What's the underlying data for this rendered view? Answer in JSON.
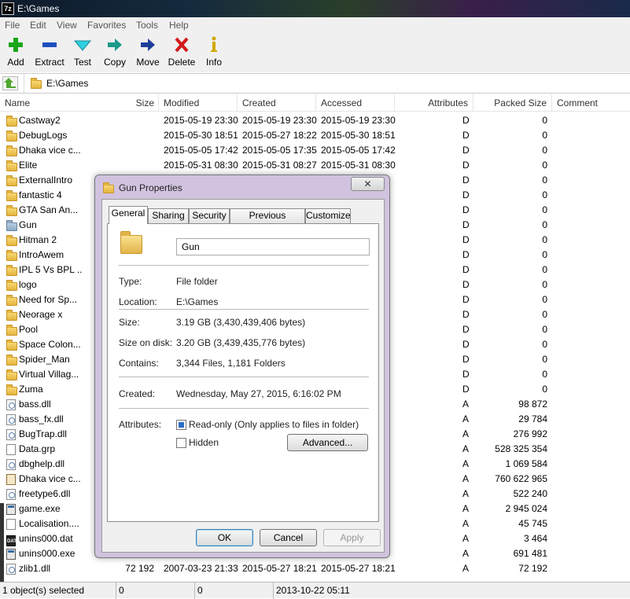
{
  "window": {
    "title": "E:\\Games",
    "app_icon_text": "7z"
  },
  "menu": [
    "File",
    "Edit",
    "View",
    "Favorites",
    "Tools",
    "Help"
  ],
  "toolbar": [
    {
      "label": "Add",
      "icon": "plus-icon"
    },
    {
      "label": "Extract",
      "icon": "minus-icon"
    },
    {
      "label": "Test",
      "icon": "check-icon"
    },
    {
      "label": "Copy",
      "icon": "copy-arrow-icon"
    },
    {
      "label": "Move",
      "icon": "move-arrow-icon"
    },
    {
      "label": "Delete",
      "icon": "x-icon"
    },
    {
      "label": "Info",
      "icon": "info-icon"
    }
  ],
  "address": {
    "path": "E:\\Games"
  },
  "columns": [
    "Name",
    "Size",
    "Modified",
    "Created",
    "Accessed",
    "Attributes",
    "Packed Size",
    "Comment"
  ],
  "rows": [
    {
      "name": "Castway2",
      "icon": "folder",
      "size": "",
      "modified": "2015-05-19 23:30",
      "created": "2015-05-19 23:30",
      "accessed": "2015-05-19 23:30",
      "attr": "D",
      "packed": "0"
    },
    {
      "name": "DebugLogs",
      "icon": "folder",
      "size": "",
      "modified": "2015-05-30 18:51",
      "created": "2015-05-27 18:22",
      "accessed": "2015-05-30 18:51",
      "attr": "D",
      "packed": "0"
    },
    {
      "name": "Dhaka vice c...",
      "icon": "folder",
      "size": "",
      "modified": "2015-05-05 17:42",
      "created": "2015-05-05 17:35",
      "accessed": "2015-05-05 17:42",
      "attr": "D",
      "packed": "0"
    },
    {
      "name": "Elite",
      "icon": "folder",
      "size": "",
      "modified": "2015-05-31 08:30",
      "created": "2015-05-31 08:27",
      "accessed": "2015-05-31 08:30",
      "attr": "D",
      "packed": "0"
    },
    {
      "name": "ExternalIntro",
      "icon": "folder",
      "size": "",
      "modified": "",
      "created": "",
      "accessed": "",
      "attr": "D",
      "packed": "0"
    },
    {
      "name": "fantastic 4",
      "icon": "folder",
      "size": "",
      "modified": "",
      "created": "",
      "accessed": "",
      "attr": "D",
      "packed": "0"
    },
    {
      "name": "GTA San An...",
      "icon": "folder",
      "size": "",
      "modified": "",
      "created": "",
      "accessed": "",
      "attr": "D",
      "packed": "0"
    },
    {
      "name": "Gun",
      "icon": "folder-gun",
      "size": "",
      "modified": "",
      "created": "",
      "accessed": "",
      "attr": "D",
      "packed": "0"
    },
    {
      "name": "Hitman 2",
      "icon": "folder",
      "size": "",
      "modified": "",
      "created": "",
      "accessed": "",
      "attr": "D",
      "packed": "0"
    },
    {
      "name": "IntroAwem",
      "icon": "folder",
      "size": "",
      "modified": "",
      "created": "",
      "accessed": "",
      "attr": "D",
      "packed": "0"
    },
    {
      "name": "IPL 5 Vs BPL ...",
      "icon": "folder",
      "size": "",
      "modified": "",
      "created": "",
      "accessed": "",
      "attr": "D",
      "packed": "0"
    },
    {
      "name": "logo",
      "icon": "folder",
      "size": "",
      "modified": "",
      "created": "",
      "accessed": "",
      "attr": "D",
      "packed": "0"
    },
    {
      "name": "Need for Sp...",
      "icon": "folder",
      "size": "",
      "modified": "",
      "created": "",
      "accessed": "",
      "attr": "D",
      "packed": "0"
    },
    {
      "name": "Neorage x",
      "icon": "folder",
      "size": "",
      "modified": "",
      "created": "",
      "accessed": "",
      "attr": "D",
      "packed": "0"
    },
    {
      "name": "Pool",
      "icon": "folder",
      "size": "",
      "modified": "",
      "created": "",
      "accessed": "",
      "attr": "D",
      "packed": "0"
    },
    {
      "name": "Space Colon...",
      "icon": "folder",
      "size": "",
      "modified": "",
      "created": "",
      "accessed": "",
      "attr": "D",
      "packed": "0"
    },
    {
      "name": "Spider_Man",
      "icon": "folder",
      "size": "",
      "modified": "",
      "created": "",
      "accessed": "",
      "attr": "D",
      "packed": "0"
    },
    {
      "name": "Virtual Villag...",
      "icon": "folder",
      "size": "",
      "modified": "",
      "created": "",
      "accessed": "",
      "attr": "D",
      "packed": "0"
    },
    {
      "name": "Zuma",
      "icon": "folder",
      "size": "",
      "modified": "",
      "created": "",
      "accessed": "",
      "attr": "D",
      "packed": "0"
    },
    {
      "name": "bass.dll",
      "icon": "dll",
      "size": "",
      "modified": "",
      "created": "",
      "accessed": "",
      "attr": "A",
      "packed": "98 872"
    },
    {
      "name": "bass_fx.dll",
      "icon": "dll",
      "size": "",
      "modified": "",
      "created": "",
      "accessed": "",
      "attr": "A",
      "packed": "29 784"
    },
    {
      "name": "BugTrap.dll",
      "icon": "dll",
      "size": "",
      "modified": "",
      "created": "",
      "accessed": "",
      "attr": "A",
      "packed": "276 992"
    },
    {
      "name": "Data.grp",
      "icon": "file",
      "size": "",
      "modified": "",
      "created": "",
      "accessed": "",
      "attr": "A",
      "packed": "528 325 354"
    },
    {
      "name": "dbghelp.dll",
      "icon": "dll",
      "size": "",
      "modified": "",
      "created": "",
      "accessed": "",
      "attr": "A",
      "packed": "1 069 584"
    },
    {
      "name": "Dhaka vice c...",
      "icon": "img",
      "size": "",
      "modified": "",
      "created": "",
      "accessed": "",
      "attr": "A",
      "packed": "760 622 965"
    },
    {
      "name": "freetype6.dll",
      "icon": "dll",
      "size": "",
      "modified": "",
      "created": "",
      "accessed": "",
      "attr": "A",
      "packed": "522 240"
    },
    {
      "name": "game.exe",
      "icon": "exe",
      "size": "",
      "modified": "",
      "created": "",
      "accessed": "",
      "attr": "A",
      "packed": "2 945 024"
    },
    {
      "name": "Localisation....",
      "icon": "file",
      "size": "",
      "modified": "",
      "created": "",
      "accessed": "",
      "attr": "A",
      "packed": "45 745"
    },
    {
      "name": "unins000.dat",
      "icon": "dat",
      "size": "",
      "modified": "",
      "created": "",
      "accessed": "",
      "attr": "A",
      "packed": "3 464"
    },
    {
      "name": "unins000.exe",
      "icon": "exe",
      "size": "",
      "modified": "",
      "created": "",
      "accessed": "",
      "attr": "A",
      "packed": "691 481"
    },
    {
      "name": "zlib1.dll",
      "icon": "dll",
      "size": "72 192",
      "modified": "2007-03-23 21:33",
      "created": "2015-05-27 18:21",
      "accessed": "2015-05-27 18:21",
      "attr": "A",
      "packed": "72 192"
    }
  ],
  "status": [
    "1 object(s) selected",
    "0",
    "0",
    "2013-10-22 05:11"
  ],
  "dialog": {
    "title": "Gun Properties",
    "close": "✕",
    "tabs": [
      "General",
      "Sharing",
      "Security",
      "Previous Versions",
      "Customize"
    ],
    "name_value": "Gun",
    "props": [
      {
        "label": "Type:",
        "value": "File folder"
      },
      {
        "label": "Location:",
        "value": "E:\\Games"
      },
      {
        "label": "Size:",
        "value": "3.19 GB (3,430,439,406 bytes)"
      },
      {
        "label": "Size on disk:",
        "value": "3.20 GB (3,439,435,776 bytes)"
      },
      {
        "label": "Contains:",
        "value": "3,344 Files, 1,181 Folders"
      },
      {
        "label": "Created:",
        "value": "Wednesday, May 27, 2015, 6:16:02 PM"
      }
    ],
    "attributes_label": "Attributes:",
    "readonly_label": "Read-only (Only applies to files in folder)",
    "hidden_label": "Hidden",
    "advanced_label": "Advanced...",
    "ok_label": "OK",
    "cancel_label": "Cancel",
    "apply_label": "Apply"
  }
}
